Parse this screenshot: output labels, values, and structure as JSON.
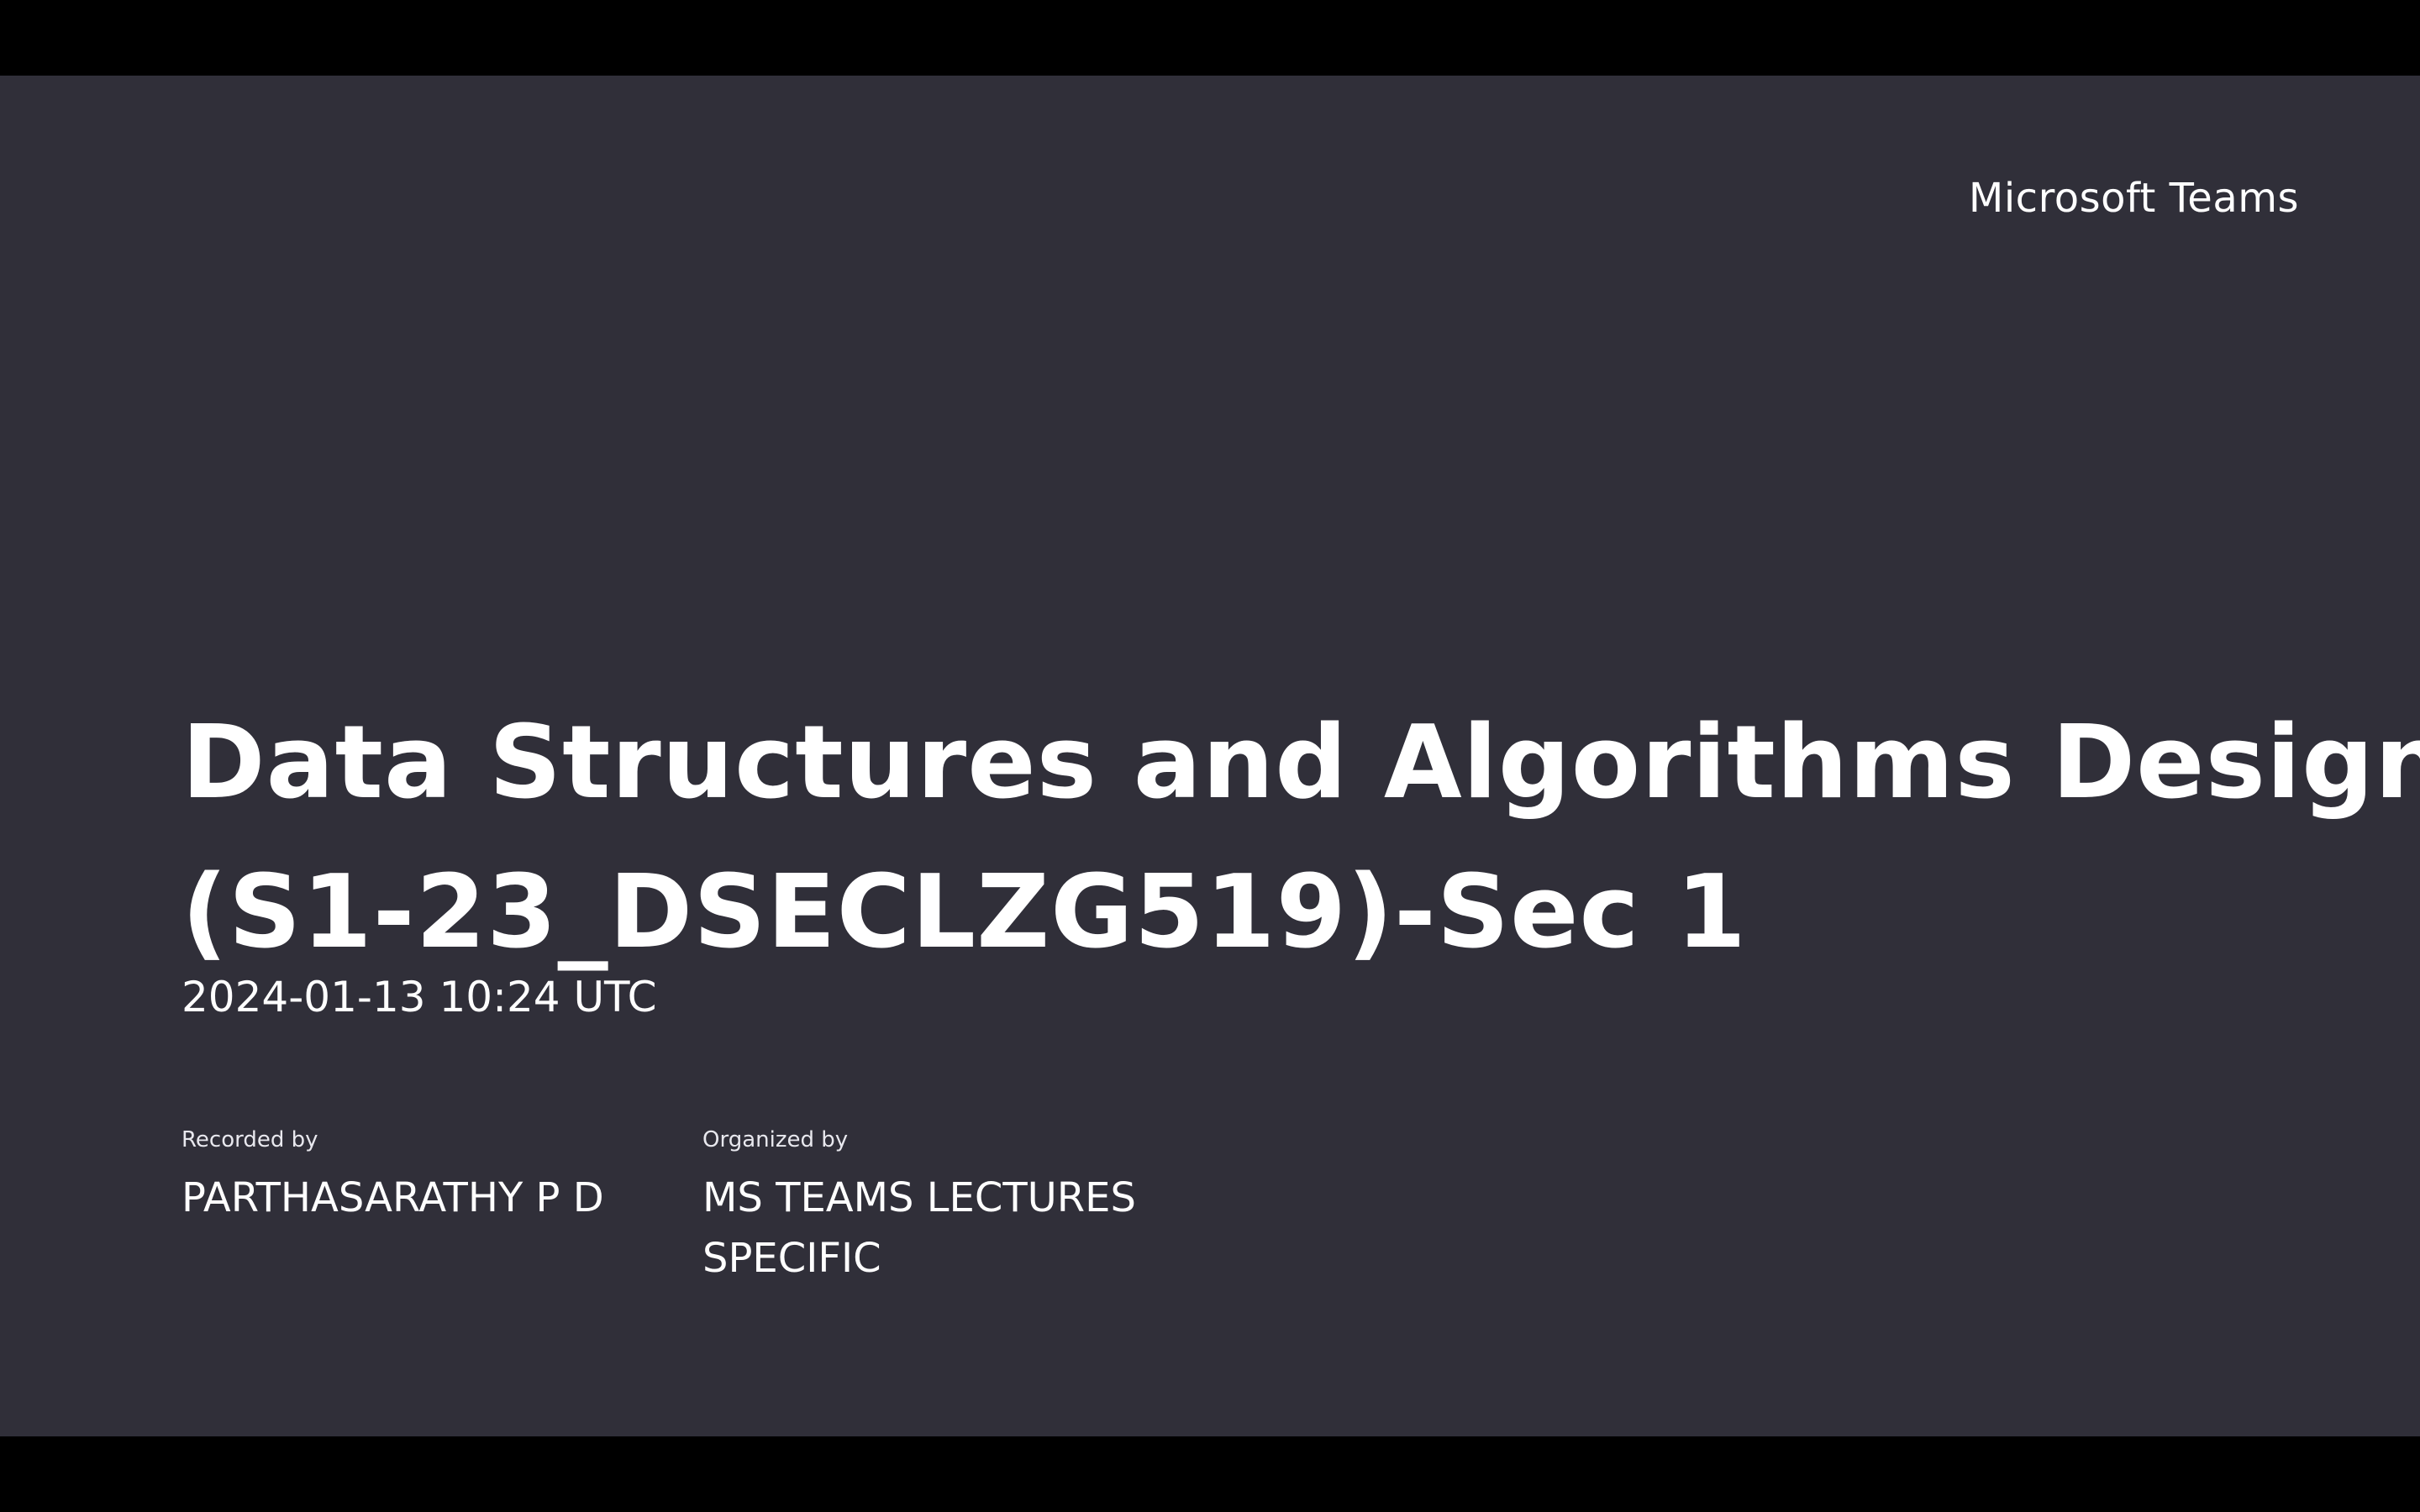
{
  "brand": "Microsoft Teams",
  "title": {
    "line1": "Data Structures and Algorithms Design",
    "line2": "(S1-23_DSECLZG519)-Sec 1"
  },
  "datetime": "2024-01-13 10:24 UTC",
  "recorded_by": {
    "label": "Recorded by",
    "value": "PARTHASARATHY P D"
  },
  "organized_by": {
    "label": "Organized by",
    "value_line1": "MS TEAMS LECTURES",
    "value_line2": "SPECIFIC"
  },
  "colors": {
    "background": "#302f39",
    "letterbox": "#000000",
    "text": "#ffffff"
  }
}
